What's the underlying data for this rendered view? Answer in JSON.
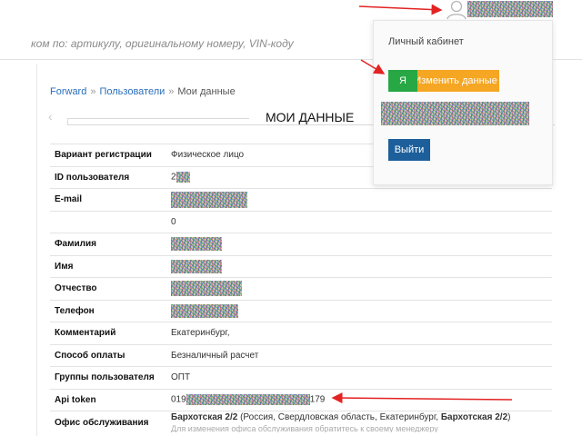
{
  "search": {
    "placeholder": "ком по: артикулу, оригинальному номеру, VIN-коду"
  },
  "breadcrumb": {
    "items": [
      "Forward",
      "Пользователи",
      "Мои данные"
    ],
    "separator": "»"
  },
  "page": {
    "title": "МОИ ДАННЫЕ"
  },
  "profile": {
    "rows": [
      {
        "label": "Вариант регистрации",
        "value": "Физическое лицо"
      },
      {
        "label": "ID пользователя",
        "value": "2"
      },
      {
        "label": "E-mail",
        "value": ""
      },
      {
        "label": "",
        "value": "0"
      },
      {
        "label": "Фамилия",
        "value": ""
      },
      {
        "label": "Имя",
        "value": ""
      },
      {
        "label": "Отчество",
        "value": ""
      },
      {
        "label": "Телефон",
        "value": ""
      },
      {
        "label": "Комментарий",
        "value": "Екатеринбург,"
      },
      {
        "label": "Способ оплаты",
        "value": "Безналичный расчет"
      },
      {
        "label": "Группы пользователя",
        "value": "ОПТ"
      },
      {
        "label": "Api token",
        "value_prefix": "019",
        "value_suffix": "179"
      },
      {
        "label": "Офис обслуживания",
        "office_name": "Бархотская 2/2",
        "office_location": "(Россия, Свердловская область, Екатеринбург,",
        "office_name2": "Бархотская 2/2",
        "office_close": ")",
        "office_note": "Для изменения офиса обслуживания обратитесь к своему менеджеру"
      }
    ]
  },
  "dropdown": {
    "title": "Личный кабинет",
    "btn_me": "Я",
    "btn_edit": "Изменить данные",
    "btn_logout": "Выйти"
  },
  "colors": {
    "link": "#2a6ebb",
    "btn_me": "#27a844",
    "btn_edit": "#f5a623",
    "btn_logout": "#1d5f9b",
    "arrow": "#e32222"
  },
  "icons": {
    "user": "user-icon",
    "back": "chevron-left-icon"
  }
}
